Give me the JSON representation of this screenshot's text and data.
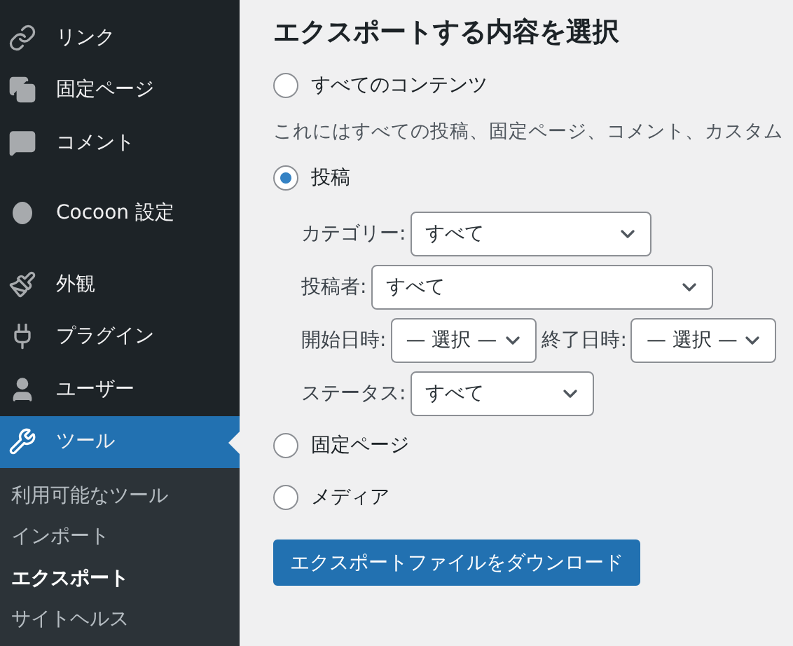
{
  "sidebar": {
    "menu_groups": [
      [
        {
          "label": "リンク",
          "selected": false
        },
        {
          "label": "固定ページ",
          "selected": false
        },
        {
          "label": "コメント",
          "selected": false
        }
      ],
      [
        {
          "label": "Cocoon 設定",
          "selected": false
        }
      ],
      [
        {
          "label": "外観",
          "selected": false
        },
        {
          "label": "プラグイン",
          "selected": false
        },
        {
          "label": "ユーザー",
          "selected": false
        },
        {
          "label": "ツール",
          "selected": true
        }
      ]
    ],
    "submenu": [
      {
        "label": "利用可能なツール",
        "selected": false
      },
      {
        "label": "インポート",
        "selected": false
      },
      {
        "label": "エクスポート",
        "selected": true
      },
      {
        "label": "サイトヘルス",
        "selected": false
      }
    ]
  },
  "main": {
    "title": "エクスポートする内容を選択",
    "options": [
      {
        "label": "すべてのコンテンツ",
        "selected": false,
        "description": "これにはすべての投稿、固定ページ、コメント、カスタム"
      },
      {
        "label": "投稿",
        "selected": true,
        "filters": [
          [
            {
              "label": "カテゴリー:",
              "value": "すべて"
            }
          ],
          [
            {
              "label": "投稿者:",
              "value": "すべて"
            }
          ],
          [
            {
              "label": "開始日時:",
              "value": "— 選択 —"
            },
            {
              "label": "終了日時:",
              "value": "— 選択 —"
            }
          ],
          [
            {
              "label": "ステータス:",
              "value": "すべて"
            }
          ]
        ]
      },
      {
        "label": "固定ページ",
        "selected": false
      },
      {
        "label": "メディア",
        "selected": false
      }
    ],
    "button": "エクスポートファイルをダウンロード"
  }
}
